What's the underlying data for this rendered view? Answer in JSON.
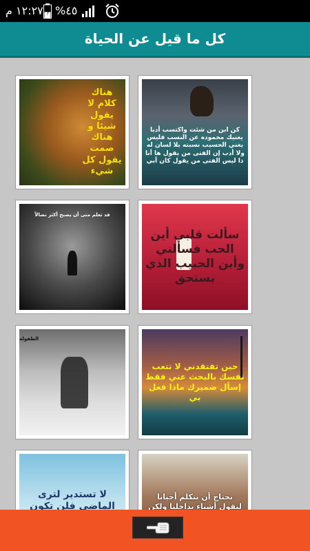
{
  "status_bar": {
    "time": "١٢:٢٧ م",
    "battery_percent": "%٤٥",
    "battery_level": 0.45,
    "icons": [
      "alarm-icon",
      "signal-icon",
      "battery-icon"
    ]
  },
  "app_bar": {
    "title": "كل ما قيل عن الحياة",
    "color": "#0e8c92"
  },
  "grid": {
    "tiles": [
      {
        "caption": "كن ابن من شئت واكتسب أدبا يغنيك محموده عن النسب فليس يغني الحسيب نسبته بلا لسان له ولا أدب إن الفتى من يقول ها أنا ذا ليس الفتى من يقول كان أبي"
      },
      {
        "caption": "هناك كلام لا يقول شيئا و هناك صمت يقول كل شيء"
      },
      {
        "caption": "سألت قلبي أين الحب فسألني وأين الحبيب الذي يستحق"
      },
      {
        "caption": "قد تعلم متى أن يصبح أكثر نضالاً"
      },
      {
        "caption": "حين تفتقدني لا تتعب نفسك بالبحث عني فقط إسأل ضميرك ماذا فعل بي"
      },
      {
        "caption": "الطفولة"
      },
      {
        "caption": "نحتاج أن نتكلم أحيانا لنقول أشياء بداخلنا ولكن سرعان ما نصمت"
      },
      {
        "caption": "لا تستدير لترى الماضي فلن تكون فيه"
      }
    ]
  },
  "bottom_bar": {
    "color": "#f25322",
    "button_icon": "pointing-hand-icon"
  }
}
